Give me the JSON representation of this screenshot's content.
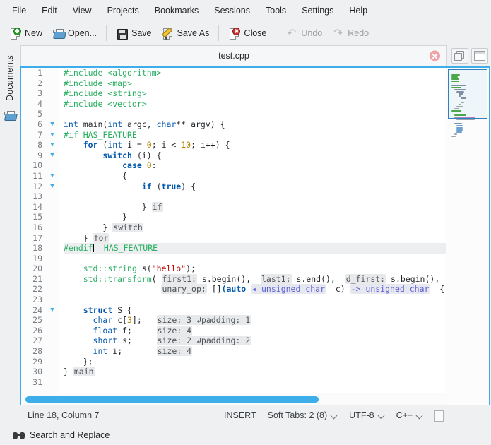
{
  "menubar": {
    "items": [
      {
        "label": "File"
      },
      {
        "label": "Edit"
      },
      {
        "label": "View"
      },
      {
        "label": "Projects"
      },
      {
        "label": "Bookmarks"
      },
      {
        "label": "Sessions"
      },
      {
        "label": "Tools"
      },
      {
        "label": "Settings"
      },
      {
        "label": "Help"
      }
    ]
  },
  "toolbar": {
    "buttons": [
      {
        "label": "New",
        "icon": "new-file-icon",
        "disabled": false
      },
      {
        "label": "Open...",
        "icon": "open-folder-icon",
        "disabled": false
      },
      {
        "label": "Save",
        "icon": "floppy-disk-icon",
        "disabled": false
      },
      {
        "label": "Save As",
        "icon": "save-as-pencil-icon",
        "disabled": false
      },
      {
        "label": "Close",
        "icon": "close-document-icon",
        "disabled": false
      },
      {
        "label": "Undo",
        "icon": "undo-arrow-icon",
        "disabled": true
      },
      {
        "label": "Redo",
        "icon": "redo-arrow-icon",
        "disabled": true
      }
    ]
  },
  "sidebar": {
    "vertical_tab": "Documents",
    "icon": "documents-folder-icon"
  },
  "tabbar": {
    "active_tab": "test.cpp",
    "close_icon": "close-icon",
    "view_buttons": [
      {
        "icon": "clone-view-icon"
      },
      {
        "icon": "split-view-icon"
      }
    ]
  },
  "editor": {
    "accent_color": "#3daee9",
    "current_line": 18,
    "total_lines": 31,
    "lines": [
      {
        "n": 1,
        "fold": false,
        "indent": 0,
        "active": false
      },
      {
        "n": 2,
        "fold": false,
        "indent": 0,
        "active": false
      },
      {
        "n": 3,
        "fold": false,
        "indent": 0,
        "active": false
      },
      {
        "n": 4,
        "fold": false,
        "indent": 0,
        "active": false
      },
      {
        "n": 5,
        "fold": false,
        "indent": 0,
        "active": false
      },
      {
        "n": 6,
        "fold": true,
        "indent": 0,
        "active": false
      },
      {
        "n": 7,
        "fold": true,
        "indent": 0,
        "active": false
      },
      {
        "n": 8,
        "fold": true,
        "indent": 1,
        "active": false
      },
      {
        "n": 9,
        "fold": true,
        "indent": 2,
        "active": false
      },
      {
        "n": 10,
        "fold": false,
        "indent": 3,
        "active": false
      },
      {
        "n": 11,
        "fold": true,
        "indent": 3,
        "active": false
      },
      {
        "n": 12,
        "fold": true,
        "indent": 4,
        "active": false
      },
      {
        "n": 13,
        "fold": false,
        "indent": 0,
        "active": false
      },
      {
        "n": 14,
        "fold": false,
        "indent": 4,
        "active": false
      },
      {
        "n": 15,
        "fold": false,
        "indent": 3,
        "active": false
      },
      {
        "n": 16,
        "fold": false,
        "indent": 2,
        "active": false
      },
      {
        "n": 17,
        "fold": false,
        "indent": 1,
        "active": false
      },
      {
        "n": 18,
        "fold": false,
        "indent": 0,
        "active": true
      },
      {
        "n": 19,
        "fold": false,
        "indent": 0,
        "active": false
      },
      {
        "n": 20,
        "fold": false,
        "indent": 1,
        "active": false
      },
      {
        "n": 21,
        "fold": false,
        "indent": 1,
        "active": false
      },
      {
        "n": 22,
        "fold": false,
        "indent": 5,
        "active": false
      },
      {
        "n": 23,
        "fold": false,
        "indent": 0,
        "active": false
      },
      {
        "n": 24,
        "fold": true,
        "indent": 1,
        "active": false
      },
      {
        "n": 25,
        "fold": false,
        "indent": 2,
        "active": false
      },
      {
        "n": 26,
        "fold": false,
        "indent": 2,
        "active": false
      },
      {
        "n": 27,
        "fold": false,
        "indent": 2,
        "active": false
      },
      {
        "n": 28,
        "fold": false,
        "indent": 2,
        "active": false
      },
      {
        "n": 29,
        "fold": false,
        "indent": 1,
        "active": false
      },
      {
        "n": 30,
        "fold": false,
        "indent": 0,
        "active": false
      },
      {
        "n": 31,
        "fold": false,
        "indent": 0,
        "active": false
      }
    ],
    "code_text": {
      "l1": "#include <algorithm>",
      "l2": "#include <map>",
      "l3": "#include <string>",
      "l4": "#include <vector>",
      "l5": "",
      "l6": "int main(int argc, char** argv) {",
      "l7": "#if HAS_FEATURE",
      "l8": "    for (int i = 0; i < 10; i++) {",
      "l9": "        switch (i) {",
      "l10": "            case 0:",
      "l11": "            {",
      "l12": "                if (true) {",
      "l13": "",
      "l14": "                } <= if",
      "l15": "            }",
      "l16": "        } <= switch",
      "l17": "    } <= for",
      "l18": "#endif  HAS_FEATURE",
      "l19": "",
      "l20": "    std::string s(\"hello\");",
      "l21": "    std::transform( first1: s.begin(),  last1: s.end(),  d_first: s.begin(),",
      "l22": "                    unary_op: [](auto < unsigned char  c) -> unsigned char  {",
      "l23": "",
      "l24": "    struct S {",
      "l25": "      char c[3];    size: 3 ↵padding: 1",
      "l26": "      float f;      size: 4",
      "l27": "      short s;      size: 2 ↵padding: 2",
      "l28": "      int i;        size: 4",
      "l29": "    };",
      "l30": "} <= main",
      "l31": ""
    },
    "inlay_hints": {
      "if": "if",
      "switch": "switch",
      "for": "for",
      "main": "main",
      "first1": "first1:",
      "last1": "last1:",
      "d_first": "d_first:",
      "unary_op": "unary_op:",
      "auto_type": "unsigned char",
      "return_type": "-> unsigned char",
      "size3": "size: 3",
      "pad1": "padding: 1",
      "size4a": "size: 4",
      "size2": "size: 2",
      "pad2": "padding: 2",
      "size4b": "size: 4",
      "endif_hint": "HAS_FEATURE"
    }
  },
  "statusbar": {
    "position": "Line 18, Column 7",
    "insert_mode": "INSERT",
    "tabs": "Soft Tabs: 2 (8)",
    "encoding": "UTF-8",
    "language": "C++",
    "doc_icon": "document-mode-icon"
  },
  "bottombar": {
    "search_label": "Search and Replace",
    "search_icon": "binoculars-icon"
  }
}
